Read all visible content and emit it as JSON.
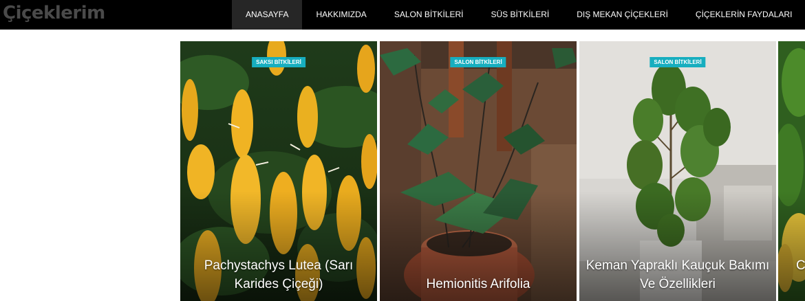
{
  "site": {
    "logo": "Çiçeklerim"
  },
  "nav": [
    {
      "label": "ANASAYFA",
      "active": true
    },
    {
      "label": "HAKKIMIZDA",
      "active": false
    },
    {
      "label": "SALON BİTKİLERİ",
      "active": false
    },
    {
      "label": "SÜS BİTKİLERİ",
      "active": false
    },
    {
      "label": "DIŞ MEKAN ÇİÇEKLERİ",
      "active": false
    },
    {
      "label": "ÇİÇEKLERİN FAYDALARI",
      "active": false
    }
  ],
  "cards": [
    {
      "category": "SAKSI BİTKİLERİ",
      "title": "Pachystachys Lutea (Sarı Karides Çiçeği)"
    },
    {
      "category": "SALON BİTKİLERİ",
      "title": "Hemionitis Arifolia"
    },
    {
      "category": "SALON BİTKİLERİ",
      "title": "Keman Yapraklı Kauçuk Bakımı Ve Özellikleri"
    },
    {
      "title": "C"
    }
  ],
  "colors": {
    "topbar": "#000000",
    "nav_active": "#262626",
    "badge": "#17aebf",
    "logo": "#4a4a4a"
  }
}
